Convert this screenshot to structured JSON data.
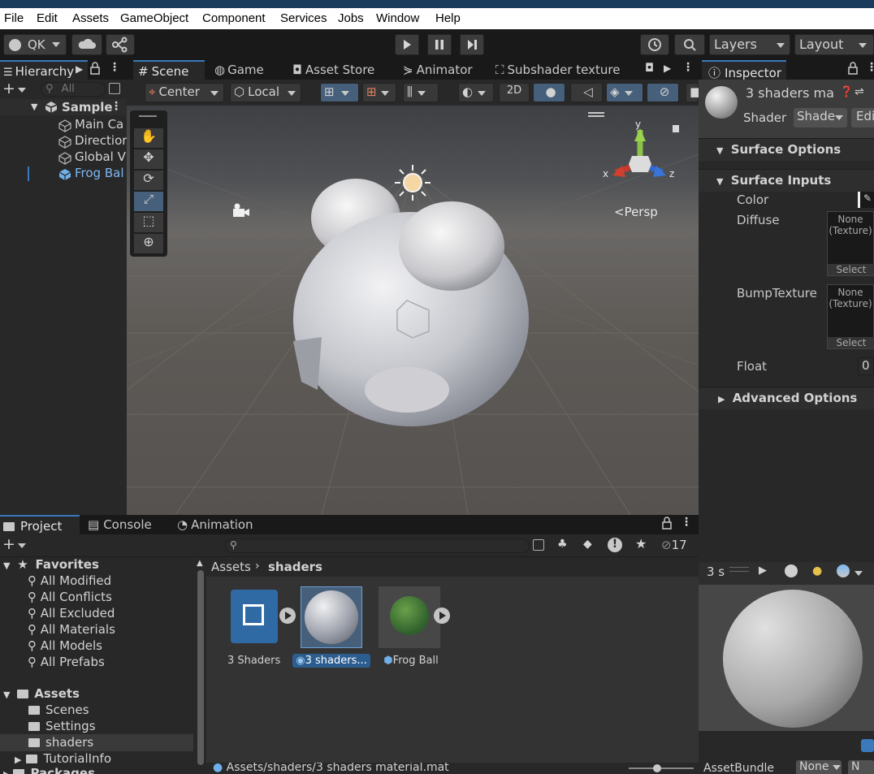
{
  "menu": [
    "File",
    "Edit",
    "Assets",
    "GameObject",
    "Component",
    "Services",
    "Jobs",
    "Window",
    "Help"
  ],
  "toolbar": {
    "account_label": "QK",
    "layers_label": "Layers",
    "layout_label": "Layout"
  },
  "hierarchy": {
    "tab_label": "Hierarchy",
    "search_placeholder": "All",
    "scene_name": "Sample",
    "items": [
      "Main Ca",
      "Directior",
      "Global V",
      "Frog Bal"
    ]
  },
  "scene_tabs": [
    "Scene",
    "Game",
    "Asset Store",
    "Animator",
    "Subshader texture"
  ],
  "scene_tools": {
    "pivot": "Center",
    "space": "Local",
    "mode_2d": "2D",
    "persp_label": "<Persp"
  },
  "inspector": {
    "tab_label": "Inspector",
    "object_name": "3 shaders ma",
    "shader_label": "Shader",
    "shader_value": "Shadе",
    "edit_label": "Edi",
    "surface_options": "Surface Options",
    "surface_inputs": "Surface Inputs",
    "color_label": "Color",
    "diffuse_label": "Diffuse",
    "diffuse_none": "None",
    "diffuse_type": "(Texture)",
    "select_label": "Select",
    "bump_label": "BumpTexture",
    "bump_none": "None",
    "bump_type": "(Texture)",
    "bump_select": "Select",
    "float_label": "Float",
    "float_value": "0",
    "advanced_options": "Advanced Options",
    "preview_title": "3 s",
    "assetbundle_label": "AssetBundle",
    "assetbundle_value": "None",
    "assetbundle_variant": "N"
  },
  "project": {
    "tabs": [
      "Project",
      "Console",
      "Animation"
    ],
    "hidden_count": "17",
    "favorites_label": "Favorites",
    "favorites": [
      "All Modified",
      "All Conflicts",
      "All Excluded",
      "All Materials",
      "All Models",
      "All Prefabs"
    ],
    "assets_label": "Assets",
    "folders": [
      "Scenes",
      "Settings",
      "shaders",
      "TutorialInfo"
    ],
    "packages_label": "Packages",
    "breadcrumb_root": "Assets",
    "breadcrumb_leaf": "shaders",
    "assets": [
      "3 Shaders",
      "3 shaders...",
      "Frog Ball"
    ],
    "status_path": "Assets/shaders/3 shaders material.mat"
  }
}
